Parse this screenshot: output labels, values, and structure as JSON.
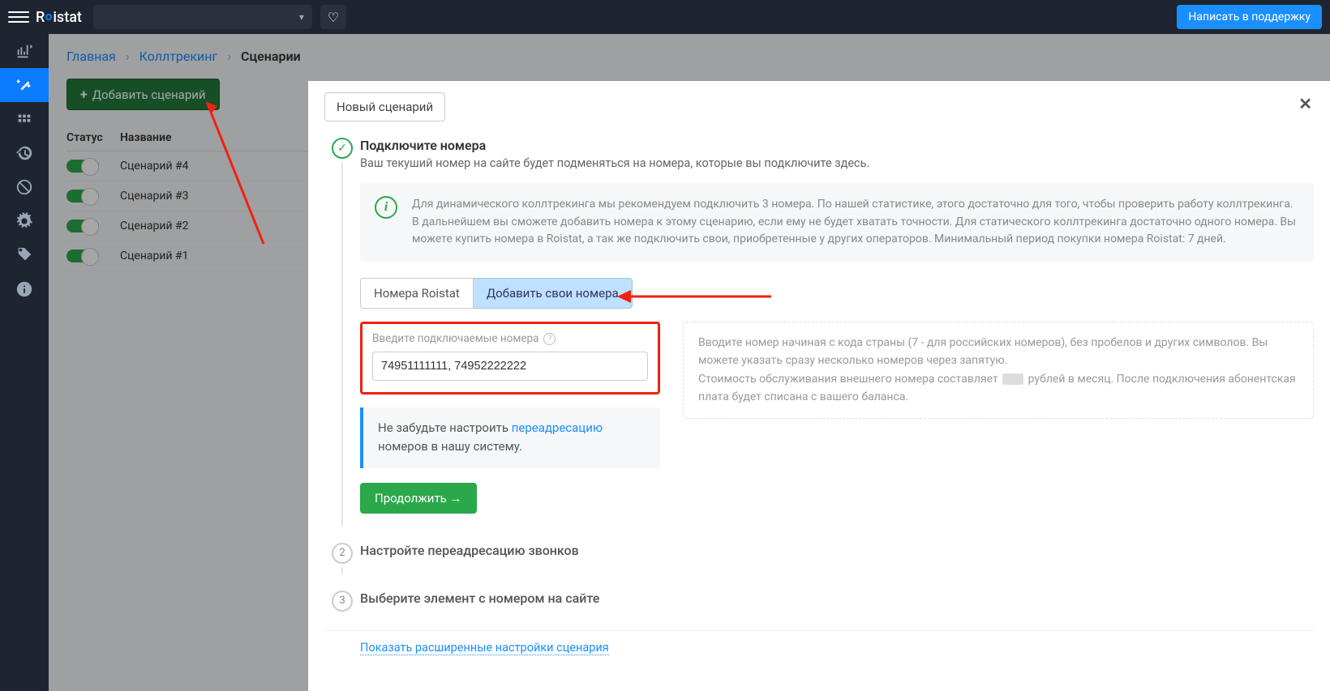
{
  "topbar": {
    "logo": "Roistat",
    "support_label": "Написать в поддержку"
  },
  "breadcrumb": {
    "home": "Главная",
    "section": "Коллтрекинг",
    "current": "Сценарии"
  },
  "add_button": "Добавить сценарий",
  "table": {
    "col_status": "Статус",
    "col_name": "Название",
    "rows": [
      {
        "name": "Сценарий #4"
      },
      {
        "name": "Сценарий #3"
      },
      {
        "name": "Сценарий #2"
      },
      {
        "name": "Сценарий #1"
      }
    ]
  },
  "modal": {
    "title": "Новый сценарий",
    "step1": {
      "title": "Подключите номера",
      "sub": "Ваш текуший номер на сайте будет подменяться на номера, которые вы подключите здесь.",
      "info": "Для динамического коллтрекинга мы рекомендуем подключить 3 номера. По нашей статистике, этого достаточно для того, чтобы проверить работу коллтрекинга. В дальнейшем вы сможете добавить номера к этому сценарию, если ему не будет хватать точности. Для статического коллтрекинга достаточно одного номера. Вы можете купить номера в Roistat, а так же подключить свои, приобретенные у других операторов. Минимальный период покупки номера Roistat: 7 дней.",
      "tab_roistat": "Номера Roistat",
      "tab_own": "Добавить свои номера",
      "field_label": "Введите подключаемые номера",
      "field_value": "74951111111, 74952222222",
      "hint_pre": "Не забудьте настроить ",
      "hint_link": "переадресацию",
      "hint_post": " номеров в нашу систему.",
      "right_p1": "Вводите номер начиная с кода страны (7 - для российских номеров), без пробелов и других символов. Вы можете указать сразу несколько номеров через запятую.",
      "right_p2a": "Стоимость обслуживания внешнего номера составляет ",
      "right_p2b": " рублей в месяц. После подключения абонентская плата будет списана с вашего баланса.",
      "continue": "Продолжить →"
    },
    "step2": {
      "title": "Настройте переадресацию звонков"
    },
    "step3": {
      "title": "Выберите элемент с номером на сайте"
    },
    "advanced": "Показать расширенные настройки сценария"
  }
}
